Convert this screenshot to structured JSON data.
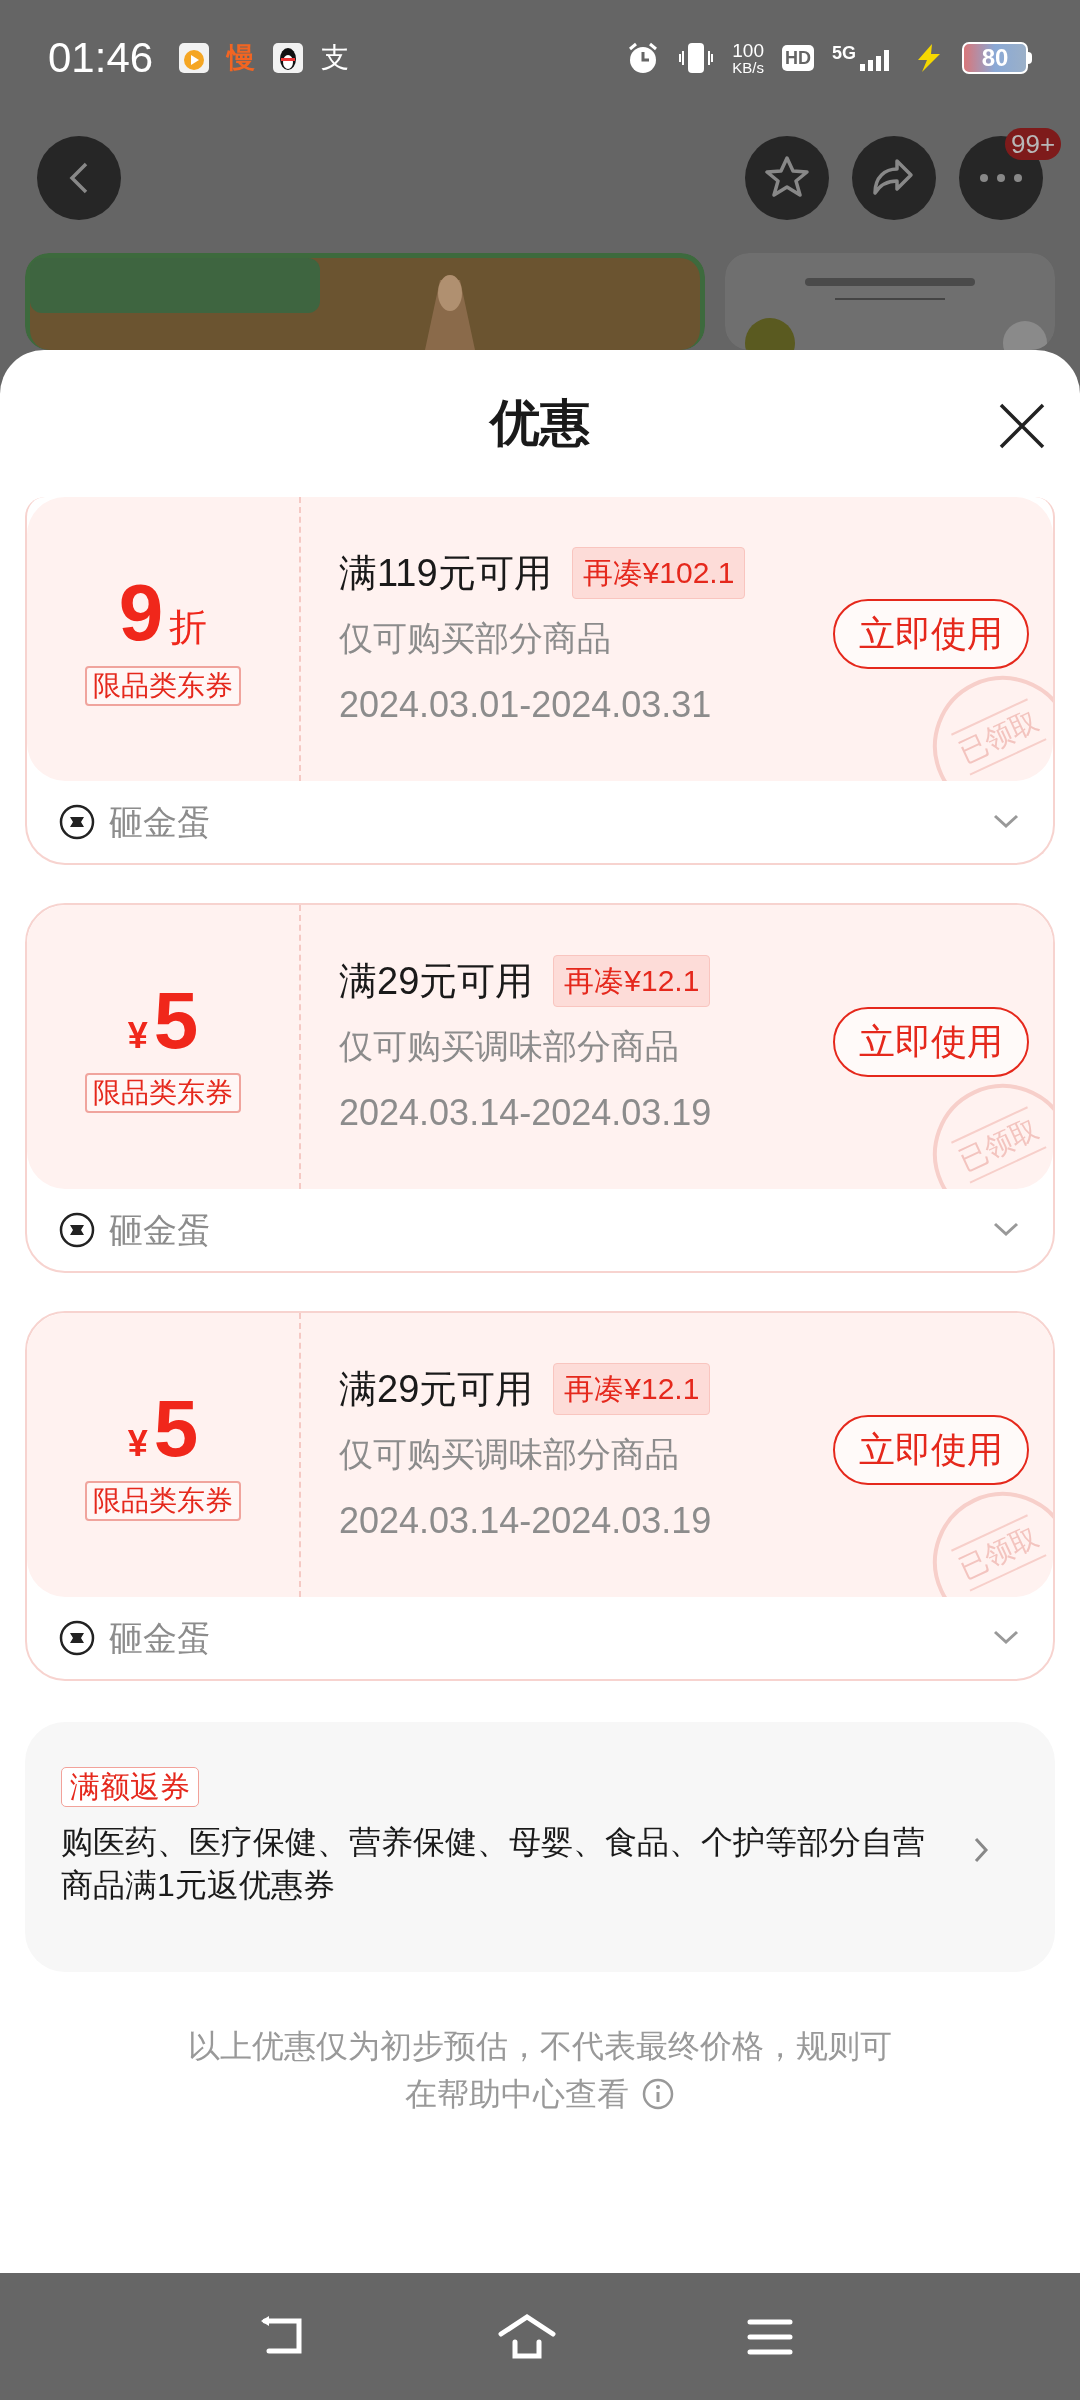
{
  "status_bar": {
    "time": "01:46",
    "notifications": [
      "慢",
      "支"
    ],
    "speed_value": "100",
    "speed_unit": "KB/s",
    "hd": "HD",
    "network": "5G",
    "battery": "80"
  },
  "top_bar": {
    "badge": "99+"
  },
  "sheet": {
    "title": "优惠",
    "coupons": [
      {
        "kind": "discount",
        "value": "9",
        "unit": "折",
        "tag": "限品类东券",
        "title": "满119元可用",
        "gap": "再凑¥102.1",
        "scope": "仅可购买部分商品",
        "dates": "2024.03.01-2024.03.31",
        "action": "立即使用",
        "claimed": true,
        "stamp": "已领取",
        "footer": "砸金蛋",
        "expanded": false
      },
      {
        "kind": "amount",
        "value": "5",
        "unit": "¥",
        "tag": "限品类东券",
        "title": "满29元可用",
        "gap": "再凑¥12.1",
        "scope": "仅可购买调味部分商品",
        "dates": "2024.03.14-2024.03.19",
        "action": "立即使用",
        "claimed": true,
        "stamp": "已领取",
        "footer": "砸金蛋",
        "expanded": false
      },
      {
        "kind": "amount",
        "value": "5",
        "unit": "¥",
        "tag": "限品类东券",
        "title": "满29元可用",
        "gap": "再凑¥12.1",
        "scope": "仅可购买调味部分商品",
        "dates": "2024.03.14-2024.03.19",
        "action": "立即使用",
        "claimed": true,
        "stamp": "已领取",
        "footer": "砸金蛋",
        "expanded": false
      }
    ],
    "rebate": {
      "tag": "满额返券",
      "text": "购医药、医疗保健、营养保健、母婴、食品、个护等部分自营商品满1元返优惠券"
    },
    "note": {
      "line1": "以上优惠仅为初步预估，不代表最终价格，规则可",
      "line2": "在帮助中心查看"
    }
  }
}
